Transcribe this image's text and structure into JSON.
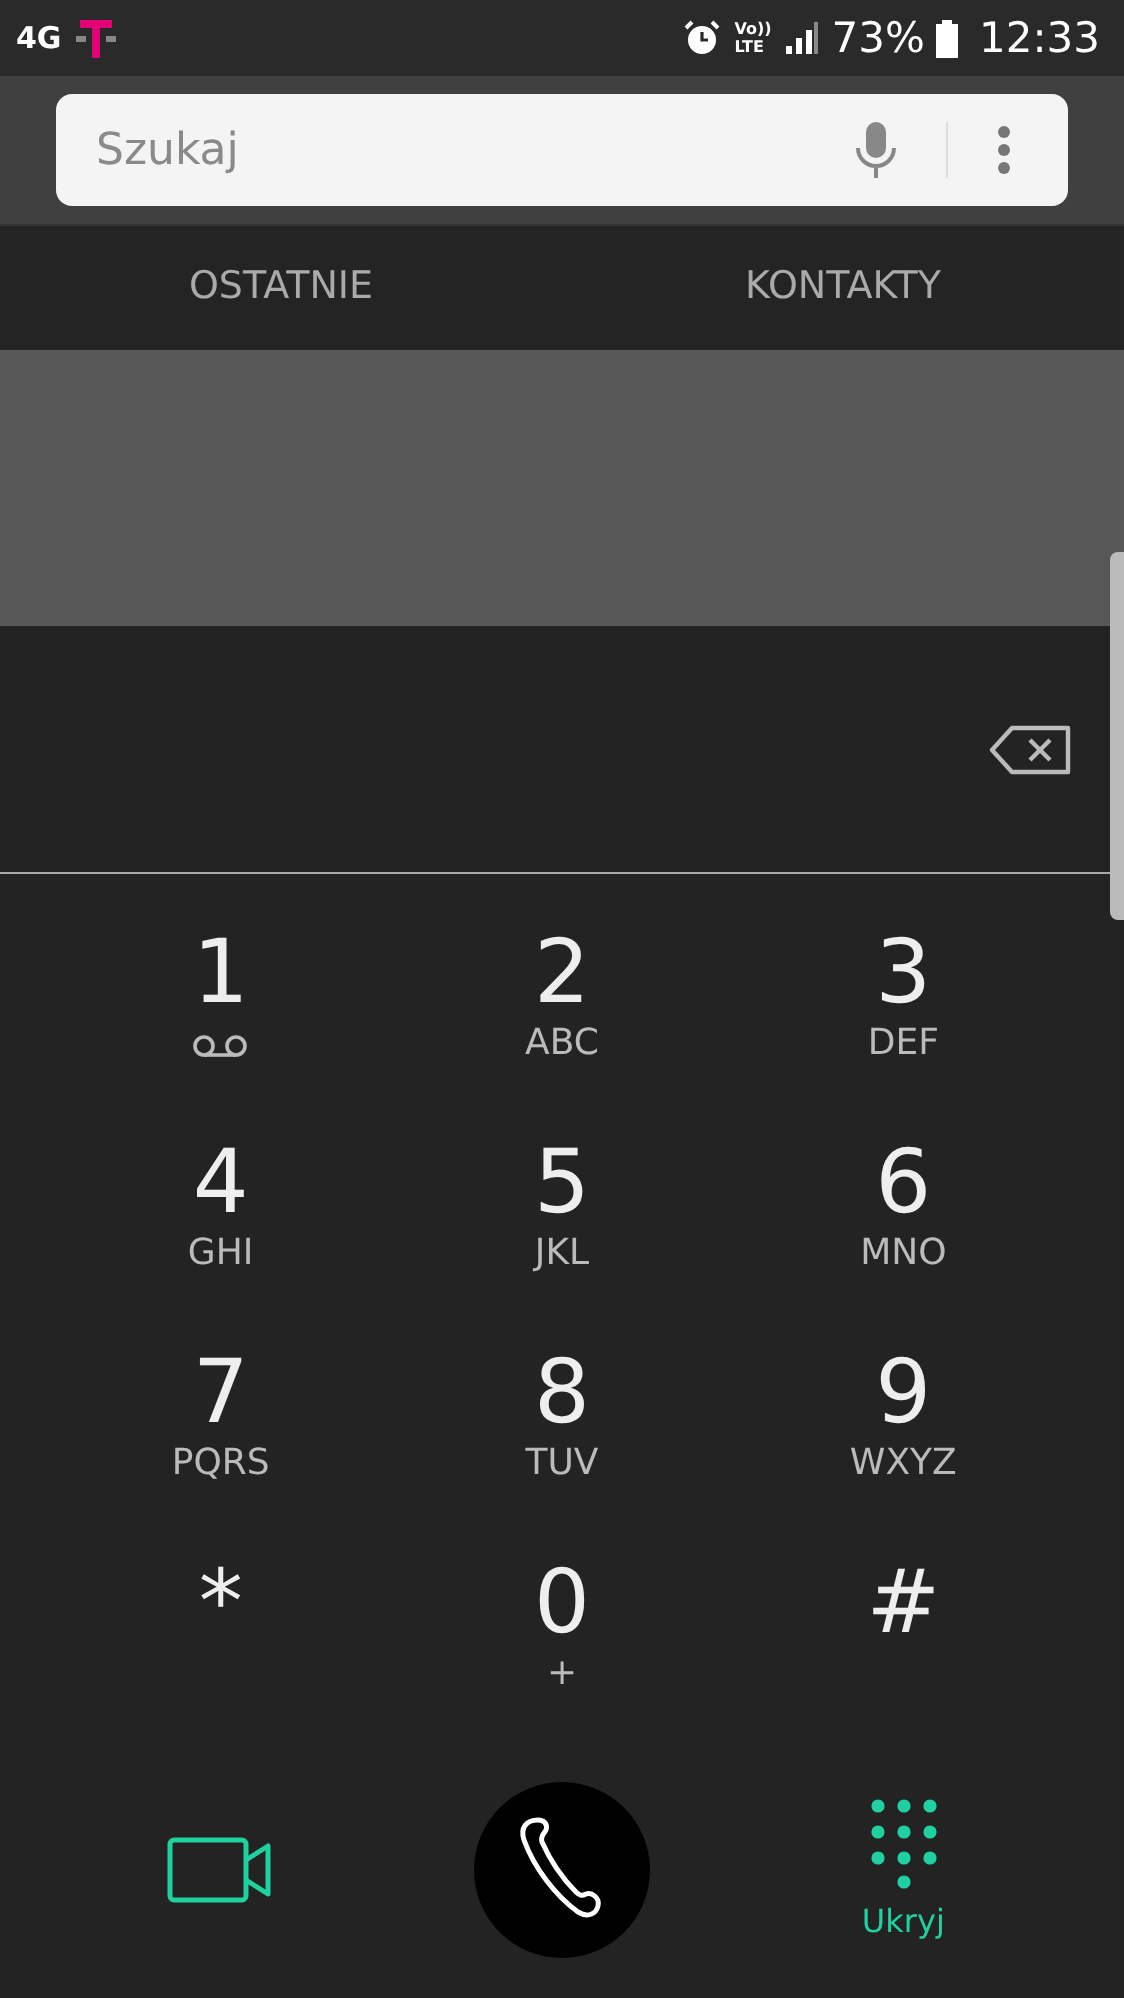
{
  "status_bar": {
    "network": "4G",
    "volte_top": "Vo))",
    "volte_bottom": "LTE",
    "battery": "73%",
    "time": "12:33"
  },
  "search": {
    "placeholder": "Szukaj"
  },
  "tabs": [
    {
      "label": "OSTATNIE",
      "selected": false
    },
    {
      "label": "KONTAKTY",
      "selected": false
    }
  ],
  "keys": [
    {
      "digit": "1",
      "kind": "voicemail"
    },
    {
      "digit": "2",
      "kind": "letters",
      "sub": "ABC"
    },
    {
      "digit": "3",
      "kind": "letters",
      "sub": "DEF"
    },
    {
      "digit": "4",
      "kind": "letters",
      "sub": "GHI"
    },
    {
      "digit": "5",
      "kind": "letters",
      "sub": "JKL"
    },
    {
      "digit": "6",
      "kind": "letters",
      "sub": "MNO"
    },
    {
      "digit": "7",
      "kind": "letters",
      "sub": "PQRS"
    },
    {
      "digit": "8",
      "kind": "letters",
      "sub": "TUV"
    },
    {
      "digit": "9",
      "kind": "letters",
      "sub": "WXYZ"
    },
    {
      "digit": "*",
      "kind": "symbol"
    },
    {
      "digit": "0",
      "kind": "letters",
      "sub": "+"
    },
    {
      "digit": "#",
      "kind": "symbol"
    }
  ],
  "hide_keypad": {
    "label": "Ukryj"
  }
}
